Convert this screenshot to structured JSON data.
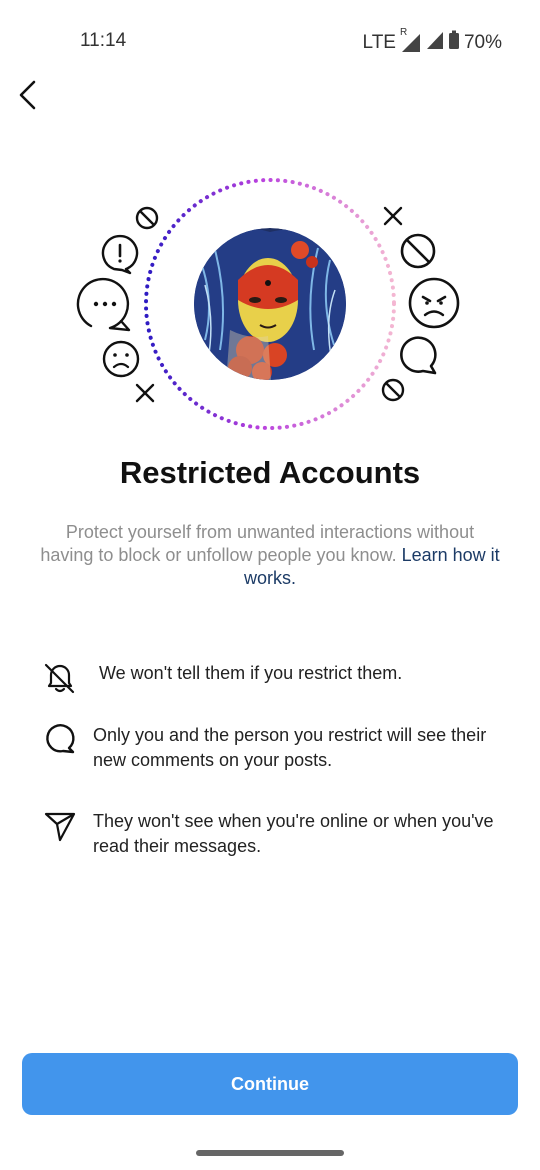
{
  "status_bar": {
    "time": "11:14",
    "network": "LTE",
    "roaming": "R",
    "battery": "70%"
  },
  "header": {
    "back_icon": "chevron-left-icon"
  },
  "hero": {
    "avatar": "profile-illustration",
    "ring_colors": [
      "#3a1fc9",
      "#b43ee0",
      "#f2a6c8"
    ],
    "left_icons": [
      "block-icon",
      "exclamation-bubble-icon",
      "ellipsis-bubble-icon",
      "sad-face-icon",
      "x-icon"
    ],
    "right_icons": [
      "x-icon",
      "block-icon",
      "angry-face-icon",
      "comment-bubble-icon",
      "block-icon"
    ]
  },
  "title": "Restricted Accounts",
  "description": {
    "text": "Protect yourself from unwanted interactions without having to block or unfollow people you know.",
    "link": "Learn how it works",
    "link_end": "."
  },
  "features": [
    {
      "icon": "muted-bell-icon",
      "text": "We won't tell them if you restrict them."
    },
    {
      "icon": "comment-icon",
      "text": "Only you and the person you restrict will see their new comments on your posts."
    },
    {
      "icon": "send-icon",
      "text": "They won't see when you're online or when you've read their messages."
    }
  ],
  "continue_button": {
    "label": "Continue",
    "color": "#4295ec"
  }
}
